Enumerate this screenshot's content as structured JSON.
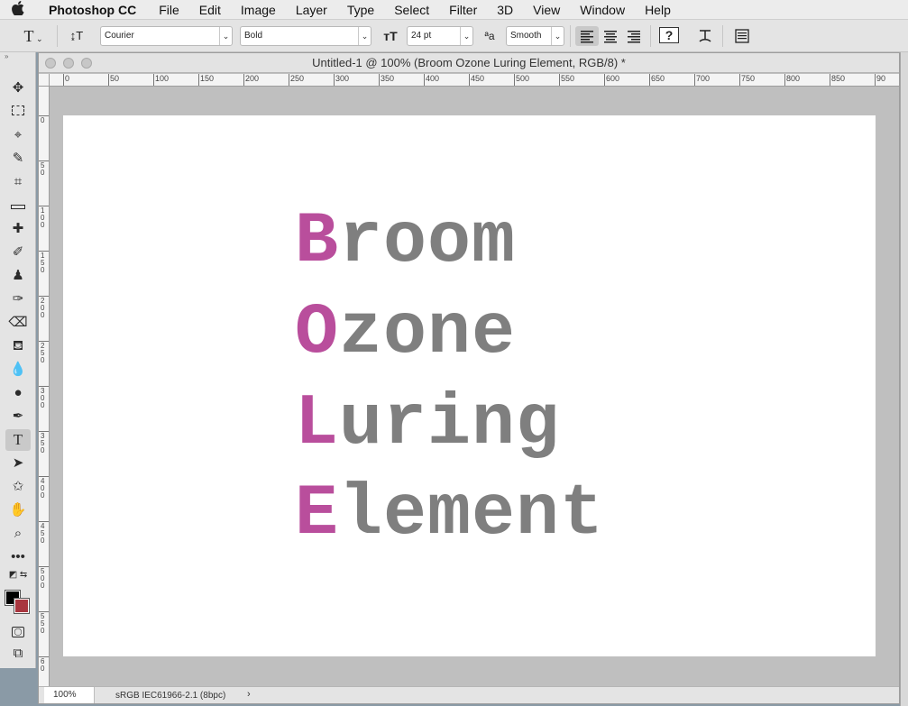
{
  "menubar": {
    "apple": "",
    "app_name": "Photoshop CC",
    "items": [
      "File",
      "Edit",
      "Image",
      "Layer",
      "Type",
      "Select",
      "Filter",
      "3D",
      "View",
      "Window",
      "Help"
    ]
  },
  "options": {
    "tool_glyph": "T",
    "orient_glyph": "↨T",
    "font_family": "Courier",
    "font_style": "Bold",
    "size_glyph": "тT",
    "font_size": "24 pt",
    "aa_glyph": "ªa",
    "antialias": "Smooth",
    "warp_glyph": "?",
    "panels_glyph": "☰"
  },
  "document": {
    "title": "Untitled-1 @ 100% (Broom Ozone Luring Element, RGB/8) *",
    "hruler_labels": [
      "0",
      "50",
      "100",
      "150",
      "200",
      "250",
      "300",
      "350",
      "400",
      "450",
      "500",
      "550",
      "600",
      "650",
      "700",
      "750",
      "800",
      "850",
      "90"
    ],
    "vruler_labels": [
      "0",
      "50",
      "100",
      "150",
      "200",
      "250",
      "300",
      "350",
      "400",
      "450",
      "500",
      "550",
      "60"
    ],
    "lines": [
      {
        "initial": "B",
        "rest": "room"
      },
      {
        "initial": "O",
        "rest": "zone"
      },
      {
        "initial": "L",
        "rest": "uring"
      },
      {
        "initial": "E",
        "rest": "lement"
      }
    ],
    "colors": {
      "initial": "#b94e9c",
      "rest": "#7f7f7f"
    }
  },
  "status": {
    "zoom": "100%",
    "profile": "sRGB IEC61966-2.1 (8bpc)",
    "arrow": "›"
  },
  "tools": {
    "foreground": "#000000",
    "background": "#a8363f"
  }
}
